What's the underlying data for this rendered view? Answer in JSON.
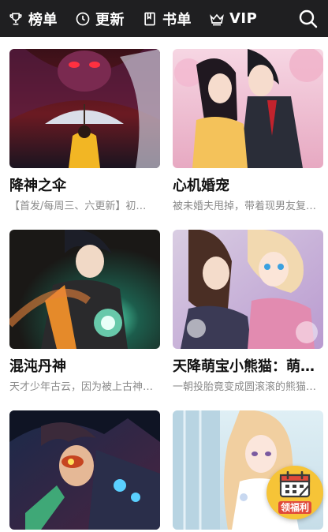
{
  "nav": {
    "items": [
      {
        "label": "榜单",
        "icon": "trophy-icon"
      },
      {
        "label": "更新",
        "icon": "clock-icon"
      },
      {
        "label": "书单",
        "icon": "book-icon"
      },
      {
        "label": "VIP",
        "icon": "crown-icon"
      }
    ],
    "search_icon": "search-icon",
    "bg_color": "#1f1f21"
  },
  "comics": [
    {
      "title": "降神之伞",
      "desc": "【首发/每周三、六更新】初…"
    },
    {
      "title": "心机婚宠",
      "desc": "被未婚夫甩掉，带着现男友复…"
    },
    {
      "title": "混沌丹神",
      "desc": "天才少年古云，因为被上古神…"
    },
    {
      "title": "天降萌宝小熊猫：萌…",
      "desc": "一朝投胎竟变成圆滚滚的熊猫…"
    },
    {
      "title": "",
      "desc": ""
    },
    {
      "title": "",
      "desc": ""
    }
  ],
  "welfare": {
    "label": "领福利",
    "icon": "calendar-icon",
    "color": "#f6c437"
  }
}
